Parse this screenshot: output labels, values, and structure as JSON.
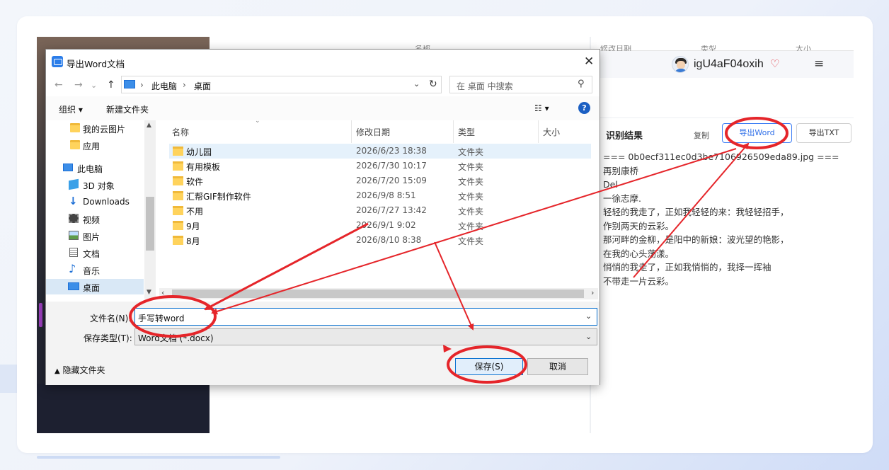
{
  "background": {
    "accent": "#3d7ef5",
    "annotation": "#e5252a"
  },
  "behind": {
    "col_name": "名称",
    "col_date": "修改日期",
    "col_type": "类型",
    "col_size": "大小"
  },
  "app": {
    "username": "igU4aF04oxih",
    "result_title": "识别结果",
    "copy_label": "复制",
    "export_word_label": "导出Word",
    "export_txt_label": "导出TXT",
    "result_lines": [
      "=== 0b0ecf311ec0d3be7106926509eda89.jpg ===",
      "再别康桥",
      "Del",
      "一徐志摩.",
      "轻轻的我走了，正如我轻轻的来：我轻轻招手，",
      "作别两天的云彩。",
      "那河畔的金柳，是阳中的新娘：波光望的艳影，",
      "在我的心头荡漾。",
      "悄悄的我走了，正如我悄悄的，我择一挥袖",
      "不带走一片云彩。"
    ]
  },
  "dialog": {
    "title": "导出Word文档",
    "address": {
      "seg1": "此电脑",
      "seg2": "桌面"
    },
    "search_placeholder": "在 桌面 中搜索",
    "toolbar": {
      "organize": "组织 ▾",
      "new_folder": "新建文件夹"
    },
    "nav_items": [
      {
        "label": "我的云图片",
        "icon": "folder-icon"
      },
      {
        "label": "应用",
        "icon": "folder-icon"
      },
      {
        "label": "此电脑",
        "icon": "computer-icon"
      },
      {
        "label": "3D 对象",
        "icon": "cube-icon"
      },
      {
        "label": "Downloads",
        "icon": "download-icon"
      },
      {
        "label": "视频",
        "icon": "video-icon"
      },
      {
        "label": "图片",
        "icon": "picture-icon"
      },
      {
        "label": "文档",
        "icon": "document-icon"
      },
      {
        "label": "音乐",
        "icon": "music-icon"
      },
      {
        "label": "桌面",
        "icon": "desktop-icon"
      }
    ],
    "columns": {
      "name": "名称",
      "date": "修改日期",
      "type": "类型",
      "size": "大小"
    },
    "files": [
      {
        "name": "幼儿园",
        "date": "2026/6/23 18:38",
        "type": "文件夹"
      },
      {
        "name": "有用模板",
        "date": "2026/7/30 10:17",
        "type": "文件夹"
      },
      {
        "name": "软件",
        "date": "2026/7/20 15:09",
        "type": "文件夹"
      },
      {
        "name": "汇帮GIF制作软件",
        "date": "2026/9/8 8:51",
        "type": "文件夹"
      },
      {
        "name": "不用",
        "date": "2026/7/27 13:42",
        "type": "文件夹"
      },
      {
        "name": "9月",
        "date": "2026/9/1 9:02",
        "type": "文件夹"
      },
      {
        "name": "8月",
        "date": "2026/8/10 8:38",
        "type": "文件夹"
      }
    ],
    "filename_label": "文件名(N):",
    "filename_value": "手写转word",
    "filetype_label": "保存类型(T):",
    "filetype_value": "Word文档 (*.docx)",
    "hide_folders": "隐藏文件夹",
    "save_label": "保存(S)",
    "cancel_label": "取消"
  }
}
